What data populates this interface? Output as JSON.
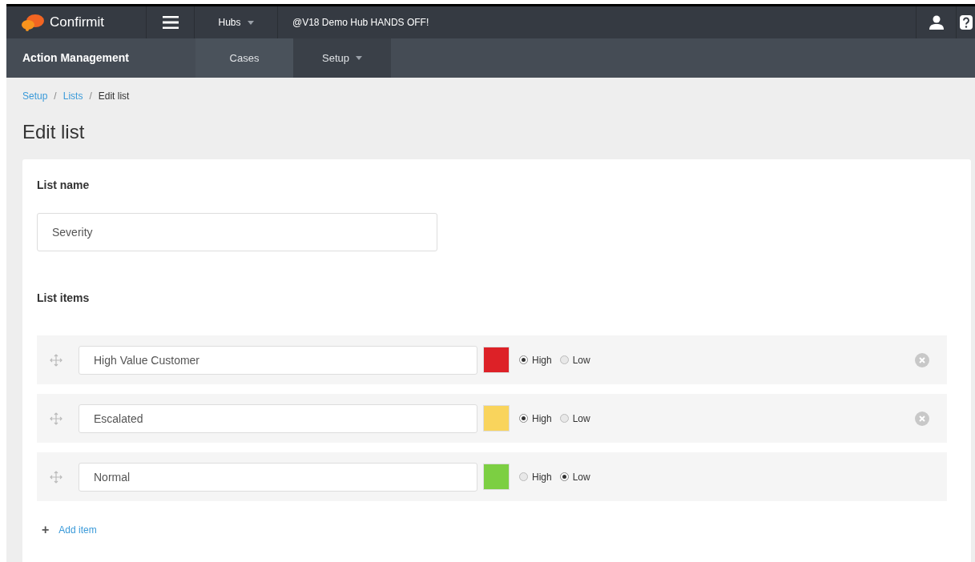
{
  "top_bar": {
    "logo": "Confirmit",
    "hubs_menu": "Hubs",
    "hub_name": "@V18 Demo Hub HANDS OFF!"
  },
  "nav_bar": {
    "title": "Action Management",
    "tabs": [
      {
        "label": "Cases",
        "selected": false,
        "dropdown": false
      },
      {
        "label": "Setup",
        "selected": true,
        "dropdown": true
      }
    ]
  },
  "breadcrumb": [
    {
      "label": "Setup",
      "link": true
    },
    {
      "separator": "/",
      "label": "Lists",
      "link": true
    },
    {
      "separator": "/",
      "label": "Edit list",
      "link": false
    }
  ],
  "page_title": "Edit list",
  "list_name": {
    "label": "List name",
    "value": "Severity"
  },
  "list_items": {
    "label": "List items",
    "items": [
      {
        "value": "High Value Customer",
        "color": "#dd2127",
        "removable": true,
        "options": [
          {
            "label": "High",
            "selected": true
          },
          {
            "label": "Low",
            "selected": false
          }
        ]
      },
      {
        "value": "Escalated",
        "color": "#f9d45c",
        "removable": true,
        "options": [
          {
            "label": "High",
            "selected": true
          },
          {
            "label": "Low",
            "selected": false
          }
        ]
      },
      {
        "value": "Normal",
        "color": "#7ccf42",
        "removable": false,
        "options": [
          {
            "label": "High",
            "selected": false
          },
          {
            "label": "Low",
            "selected": true
          }
        ]
      }
    ]
  },
  "add_item": {
    "icon": "+",
    "label": "Add item"
  }
}
